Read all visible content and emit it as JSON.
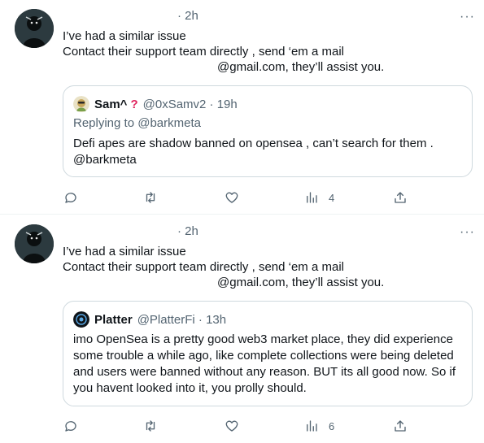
{
  "tweets": [
    {
      "time": "· 2h",
      "more": "···",
      "lines": [
        "I’ve had a similar issue",
        "Contact their support team directly , send ‘em a mail",
        "@gmail.com,  they’ll assist you."
      ],
      "quote": {
        "name": "Sam^",
        "badge": "?",
        "handle": "@0xSamv2 · 19h",
        "replying": "Replying to @barkmeta",
        "text": "Defi apes are shadow banned on opensea , can’t search for them . @barkmeta"
      },
      "actions": {
        "reply_icon": "reply-icon",
        "retweet_icon": "retweet-icon",
        "like_icon": "heart-icon",
        "views_icon": "views-icon",
        "views": "4",
        "share_icon": "share-icon"
      }
    },
    {
      "time": "· 2h",
      "more": "···",
      "lines": [
        "I’ve had a similar issue",
        "Contact their support team directly , send ‘em a mail",
        "@gmail.com,  they’ll assist you."
      ],
      "quote": {
        "name": "Platter",
        "handle": "@PlatterFi · 13h",
        "text": "imo OpenSea is a pretty good web3 market place, they did experience some trouble a while ago, like complete collections were being deleted and users were banned without any reason. BUT its all good now. So if you havent looked into it, you prolly should."
      },
      "actions": {
        "reply_icon": "reply-icon",
        "retweet_icon": "retweet-icon",
        "like_icon": "heart-icon",
        "views_icon": "views-icon",
        "views": "6",
        "share_icon": "share-icon"
      }
    }
  ]
}
